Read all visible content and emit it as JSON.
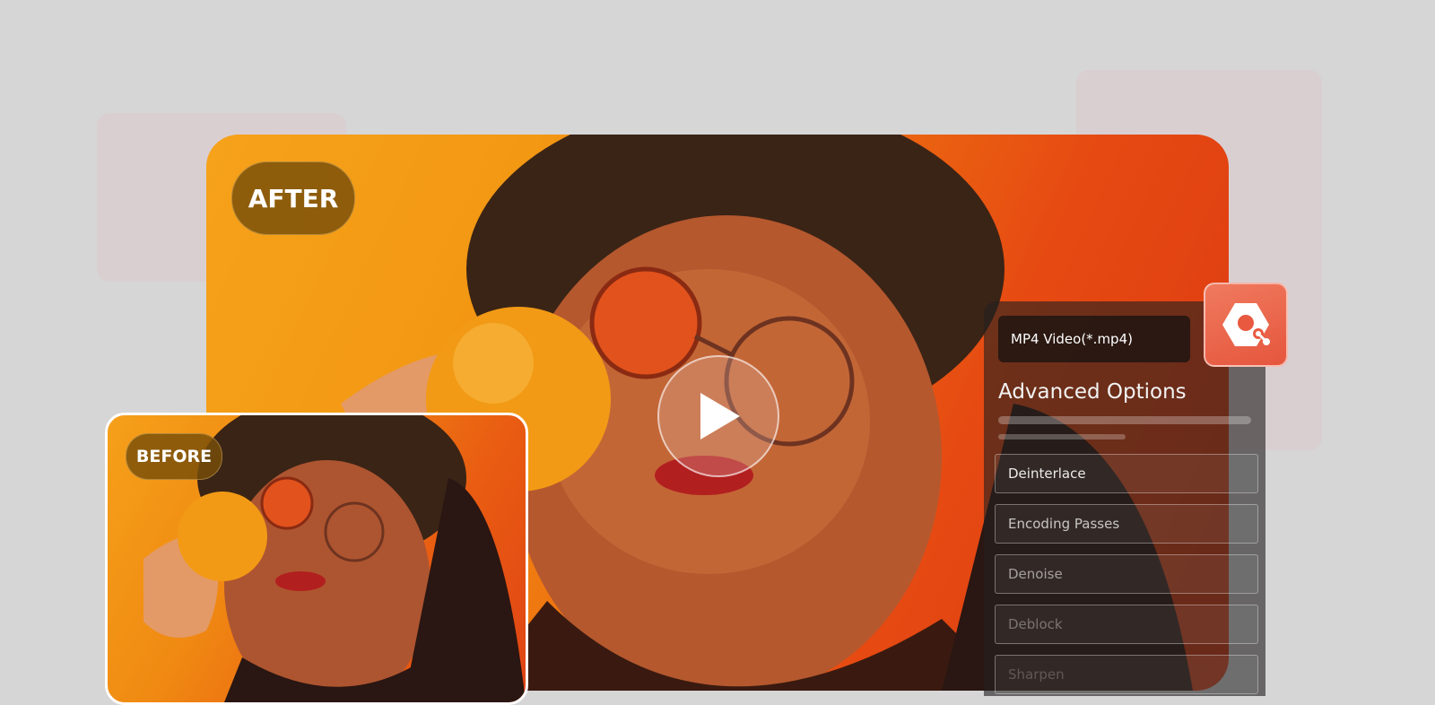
{
  "comparison": {
    "after_label": "AFTER",
    "before_label": "BEFORE"
  },
  "player": {
    "play_icon": "play-icon"
  },
  "panel": {
    "format_value": "MP4 Video(*.mp4)",
    "title": "Advanced Options",
    "options": [
      "Deinterlace",
      "Encoding Passes",
      "Denoise",
      "Deblock",
      "Sharpen"
    ]
  },
  "app": {
    "icon": "app-logo-icon"
  },
  "colors": {
    "background": "#d6d6d7",
    "accent": "#e8593f",
    "badge": "#7a4e08"
  }
}
